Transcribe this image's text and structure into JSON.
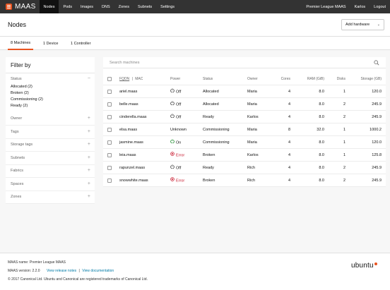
{
  "nav": {
    "logo": "MAAS",
    "items": [
      {
        "label": "Nodes",
        "active": true
      },
      {
        "label": "Pods"
      },
      {
        "label": "Images"
      },
      {
        "label": "DNS"
      },
      {
        "label": "Zones"
      },
      {
        "label": "Subnets"
      },
      {
        "label": "Settings"
      }
    ],
    "right": [
      "Premier League MAAS",
      "Karlos",
      "Logout"
    ]
  },
  "header": {
    "title": "Nodes",
    "add_hardware": "Add hardware"
  },
  "tabs": [
    {
      "label": "8 Machines",
      "active": true
    },
    {
      "label": "1 Device"
    },
    {
      "label": "1 Controller"
    }
  ],
  "filter": {
    "title": "Filter by",
    "status_label": "Status",
    "status_values": [
      "Allocated (2)",
      "Broken (2)",
      "Commissioning (2)",
      "Ready (2)"
    ],
    "facets": [
      "Owner",
      "Tags",
      "Storage tags",
      "Subnets",
      "Fabrics",
      "Spaces",
      "Zones"
    ]
  },
  "search": {
    "placeholder": "Search machines"
  },
  "table": {
    "headers": {
      "fqdn": "FQDN",
      "sep": "|",
      "mac": "MAC",
      "power": "Power",
      "status": "Status",
      "owner": "Owner",
      "cores": "Cores",
      "ram": "RAM (GiB)",
      "disks": "Disks",
      "storage": "Storage (GB)"
    },
    "rows": [
      {
        "fqdn": "ariel.maas",
        "power": "Off",
        "power_state": "off",
        "status": "Allocated",
        "owner": "Maria",
        "cores": "4",
        "ram": "8.0",
        "disks": "1",
        "storage": "120.0"
      },
      {
        "fqdn": "belle.maas",
        "power": "Off",
        "power_state": "off",
        "status": "Allocated",
        "owner": "Maria",
        "cores": "4",
        "ram": "8.0",
        "disks": "2",
        "storage": "245.9"
      },
      {
        "fqdn": "cinderella.maas",
        "power": "Off",
        "power_state": "off",
        "status": "Ready",
        "owner": "Karlos",
        "cores": "4",
        "ram": "8.0",
        "disks": "2",
        "storage": "245.9"
      },
      {
        "fqdn": "elsa.maas",
        "power": "Unknown",
        "power_state": "unknown",
        "status": "Commissioning",
        "owner": "Maria",
        "cores": "8",
        "ram": "32.0",
        "disks": "1",
        "storage": "1000.2"
      },
      {
        "fqdn": "jasmine.maas",
        "power": "On",
        "power_state": "on",
        "status": "Commissioning",
        "owner": "Maria",
        "cores": "4",
        "ram": "8.0",
        "disks": "1",
        "storage": "120.0"
      },
      {
        "fqdn": "leia.maas",
        "power": "Error",
        "power_state": "error",
        "status": "Broken",
        "owner": "Karlos",
        "cores": "4",
        "ram": "8.0",
        "disks": "1",
        "storage": "125.8"
      },
      {
        "fqdn": "rapunzel.maas",
        "power": "Off",
        "power_state": "off",
        "status": "Ready",
        "owner": "Rich",
        "cores": "4",
        "ram": "8.0",
        "disks": "2",
        "storage": "245.9"
      },
      {
        "fqdn": "snowwhite.maas",
        "power": "Error",
        "power_state": "error",
        "status": "Broken",
        "owner": "Rich",
        "cores": "4",
        "ram": "8.0",
        "disks": "2",
        "storage": "245.9"
      }
    ]
  },
  "footer": {
    "name_label": "MAAS name:",
    "name_value": "Premier League MAAS",
    "version_label": "MAAS version:",
    "version_value": "2.2.0",
    "release_notes": "View release notes",
    "link_sep": "|",
    "documentation": "View documentation",
    "copyright": "© 2017 Canonical Ltd. Ubuntu and Canonical are registered trademarks of Canonical Ltd.",
    "brand": "ubuntu"
  },
  "colors": {
    "accent": "#e95420",
    "nav_bg": "#333333",
    "error": "#c7162b",
    "on": "#0e8420",
    "link": "#007aa6"
  },
  "icons": {
    "search": "search-icon",
    "power": "power-icon",
    "error": "error-icon",
    "expand": "plus-icon",
    "collapse": "minus-icon"
  }
}
